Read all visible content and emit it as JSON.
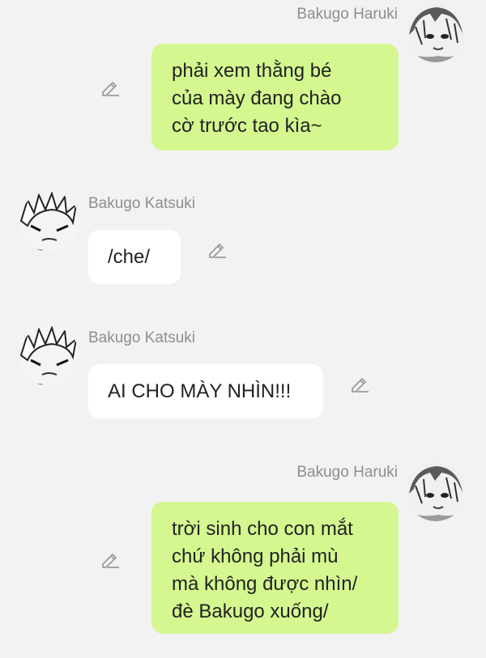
{
  "conversation": {
    "messages": [
      {
        "sender": "Bakugo Haruki",
        "side": "right",
        "text": "phải xem thằng bé\ncủa mày đang chào\ncờ trước tao kìa~"
      },
      {
        "sender": "Bakugo Katsuki",
        "side": "left",
        "text": "/che/"
      },
      {
        "sender": "Bakugo Katsuki",
        "side": "left",
        "text": "AI CHO MÀY NHÌN!!!"
      },
      {
        "sender": "Bakugo Haruki",
        "side": "right",
        "text": "trời sinh cho con mắt\nchứ không phải mù\nmà không được nhìn/\nđè Bakugo xuống/"
      }
    ]
  },
  "icons": {
    "avatar": "avatar",
    "edit": "pencil-edit-icon"
  },
  "colors": {
    "background": "#f2f2f2",
    "sent_bubble": "#d4f78f",
    "received_bubble": "#ffffff",
    "sender_name": "#8e8e8e",
    "message_text": "#222222"
  }
}
